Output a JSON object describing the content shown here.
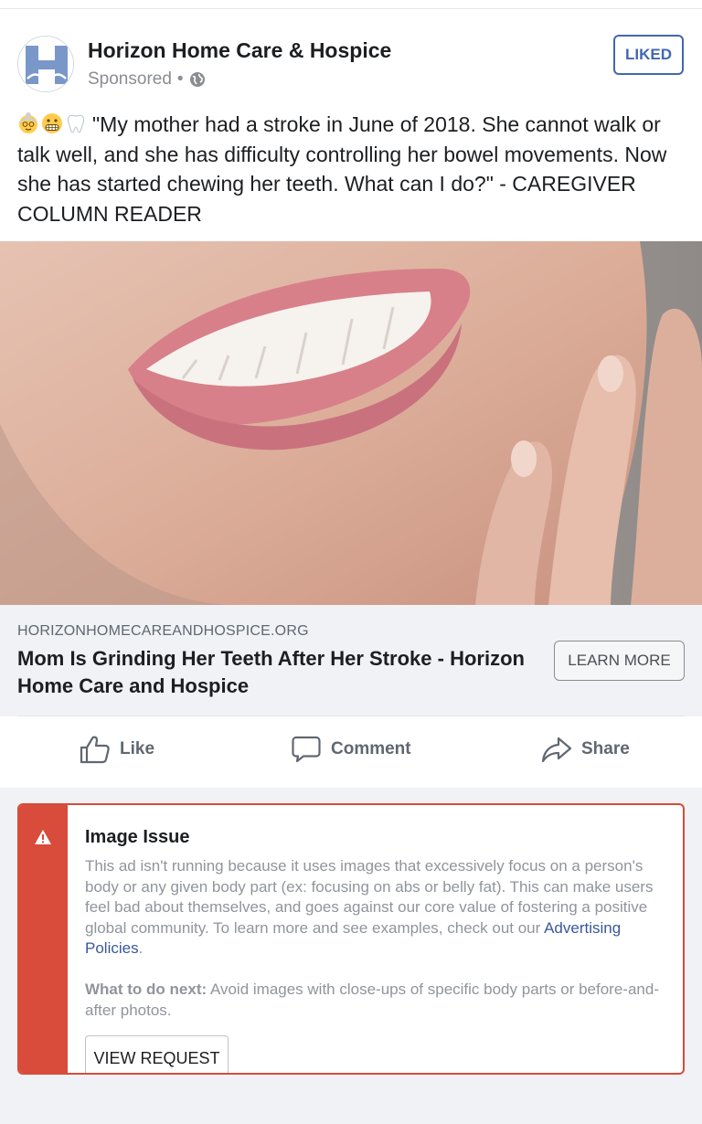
{
  "post": {
    "page_name": "Horizon Home Care & Hospice",
    "sponsored": "Sponsored",
    "meta_separator": "•",
    "liked_label": "LIKED",
    "emojis": [
      "older-woman-emoji",
      "grimacing-face-emoji",
      "tooth-emoji"
    ],
    "text": "\"My mother had a stroke in June of 2018. She cannot walk or talk well, and she has difficulty controlling her bowel movements. Now she has started chewing her teeth. What can I do?\" - CAREGIVER COLUMN READER"
  },
  "link": {
    "domain": "HORIZONHOMECAREANDHOSPICE.ORG",
    "title": "Mom Is Grinding Her Teeth After Her Stroke - Horizon Home Care and Hospice",
    "cta": "LEARN MORE"
  },
  "actions": {
    "like": "Like",
    "comment": "Comment",
    "share": "Share"
  },
  "issue": {
    "title": "Image Issue",
    "body_before_link": "This ad isn't running because it uses images that excessively focus on a person's body or any given body part (ex: focusing on abs or belly fat). This can make users feel bad about themselves, and goes against our core value of fostering a positive global community. To learn more and see examples, check out our ",
    "link_text": "Advertising Policies",
    "body_after_link": ".",
    "next_label": "What to do next:",
    "next_text": " Avoid images with close-ups of specific body parts or before-and-after photos.",
    "button": "VIEW REQUEST"
  },
  "colors": {
    "accent_blue": "#4267b2",
    "error_red": "#d94b3b",
    "link_blue": "#385898"
  }
}
